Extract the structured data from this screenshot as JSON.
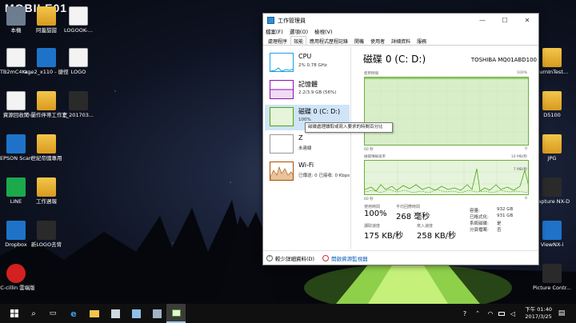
{
  "watermark": "MOBILE01",
  "desktop_icons": [
    {
      "label": "本機",
      "icon": "computer-icon"
    },
    {
      "label": "阿蓋甜甜",
      "icon": "folder-icon"
    },
    {
      "label": "LOGOOK-...",
      "icon": "document-icon"
    },
    {
      "label": "TB2mC4Kr...",
      "icon": "document-icon"
    },
    {
      "label": "age2_x110 - 捷徑",
      "icon": "game-icon"
    },
    {
      "label": "LOGO",
      "icon": "pdf-icon"
    },
    {
      "label": "資源回收筒",
      "icon": "recycle-bin-icon"
    },
    {
      "label": "小蘭作伴蒂工作室",
      "icon": "folder-icon"
    },
    {
      "label": "P_201703...",
      "icon": "photo-icon"
    },
    {
      "label": "EPSON Scan",
      "icon": "scanner-icon"
    },
    {
      "label": "世紀帝國專用",
      "icon": "folder-icon"
    },
    {
      "label": "LINE",
      "icon": "line-icon"
    },
    {
      "label": "工作週報",
      "icon": "folder-icon"
    },
    {
      "label": "Dropbox",
      "icon": "dropbox-icon"
    },
    {
      "label": "新LOGO去背",
      "icon": "image-icon"
    },
    {
      "label": "PC-cillin 雲端版",
      "icon": "antivirus-icon"
    },
    {
      "label": "BurnInTest...",
      "icon": "document-icon"
    },
    {
      "label": "D5100",
      "icon": "document-icon"
    },
    {
      "label": "JPG",
      "icon": "document-icon"
    },
    {
      "label": "Capture NX-D",
      "icon": "capture-nxd-icon"
    },
    {
      "label": "ViewNX-i",
      "icon": "viewnx-icon"
    },
    {
      "label": "Picture Contr...",
      "icon": "picture-control-icon"
    }
  ],
  "taskmgr": {
    "title": "工作管理員",
    "window_buttons": [
      "—",
      "☐",
      "✕"
    ],
    "menu": [
      "檔案(F)",
      "選項(O)",
      "檢視(V)"
    ],
    "tabs": [
      "處理程序",
      "效能",
      "應用程式歷程記錄",
      "開機",
      "使用者",
      "詳細資料",
      "服務"
    ],
    "active_tab": 1,
    "resources": [
      {
        "name": "CPU",
        "sub": "2% 0.78 GHz",
        "color": "#1ba1e2"
      },
      {
        "name": "記憶體",
        "sub": "2.2/3.9 GB (56%)",
        "color": "#8b12ae"
      },
      {
        "name": "磁碟 0 (C: D:)",
        "sub": "100%",
        "color": "#4da60c"
      },
      {
        "name": "Z",
        "sub": "未連線",
        "color": "#999999"
      },
      {
        "name": "Wi-Fi",
        "sub": "已傳送: 0  已接收: 0 Kbps",
        "color": "#a74f01"
      }
    ],
    "tooltip": "磁碟處理讀取或寫入要求的時間百分比",
    "disk_title": "磁碟 0 (C: D:)",
    "disk_model": "TOSHIBA MQ01ABD100",
    "graph1_label": "使用時間",
    "graph1_max": "100%",
    "graph1_seconds": "60 秒",
    "graph1_min": "0",
    "graph2_label": "磁碟傳輸速率",
    "graph2_max": "10 MB/秒",
    "graph2_mid": "7 MB/秒",
    "graph2_seconds": "60 秒",
    "graph2_min": "0",
    "stats": {
      "active_time_label": "使用時間",
      "active_time": "100%",
      "response_label": "平均回應時間",
      "response": "268 毫秒",
      "read_label": "讀取速度",
      "read": "175 KB/秒",
      "write_label": "寫入速度",
      "write": "258 KB/秒"
    },
    "kv": [
      {
        "k": "容量:",
        "v": "932 GB"
      },
      {
        "k": "已格式化:",
        "v": "931 GB"
      },
      {
        "k": "系統磁碟:",
        "v": "是"
      },
      {
        "k": "分頁檔案:",
        "v": "否"
      }
    ],
    "footer_less": "較少詳細資料(D)",
    "footer_monitor": "開啟資源監視器"
  },
  "taskbar": {
    "time": "下午 01:40",
    "date": "2017/3/25"
  }
}
